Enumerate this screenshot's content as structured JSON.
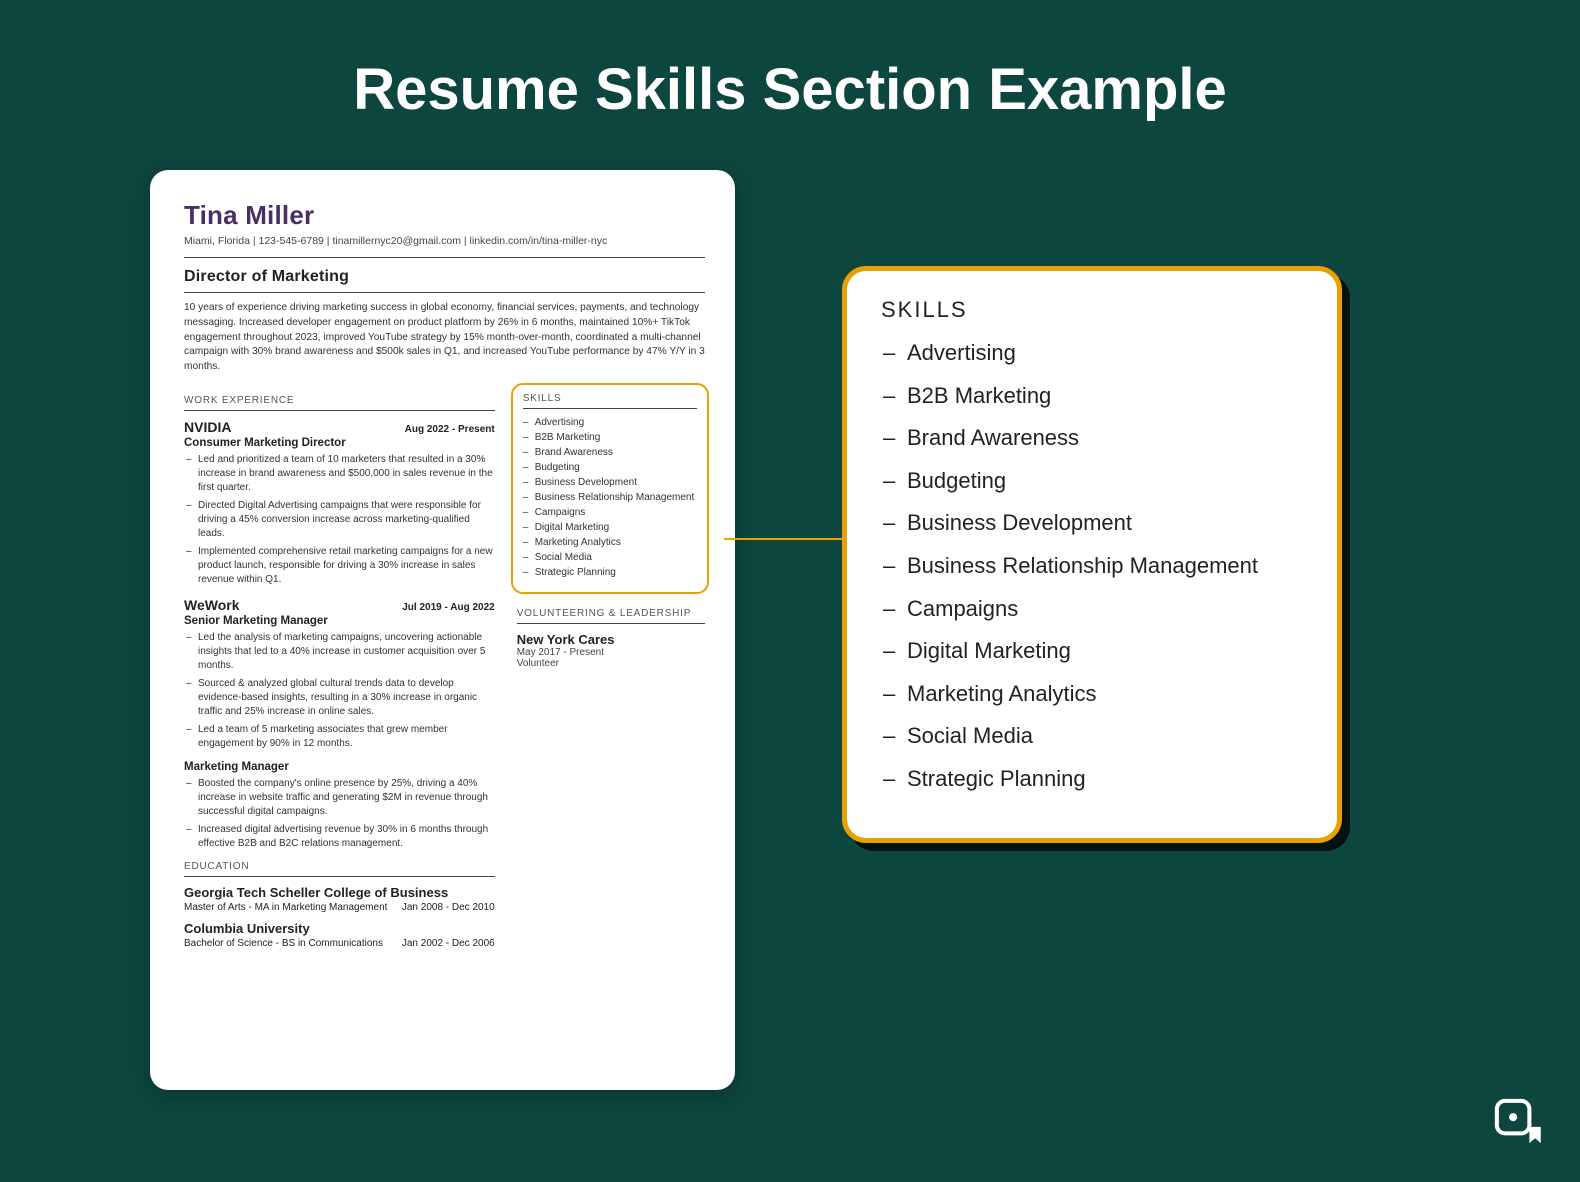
{
  "title": "Resume Skills Section Example",
  "resume": {
    "name": "Tina Miller",
    "contact": "Miami, Florida | 123-545-6789 | tinamillernyc20@gmail.com | linkedin.com/in/tina-miller-nyc",
    "role": "Director of Marketing",
    "summary": "10 years of experience driving marketing success in global economy, financial services, payments, and technology messaging. Increased developer engagement on product platform by 26% in 6 months, maintained 10%+ TikTok engagement throughout 2023, improved YouTube strategy by 15% month-over-month, coordinated a multi-channel campaign with 30% brand awareness and $500k sales in Q1, and increased YouTube performance by 47% Y/Y in 3 months.",
    "sections": {
      "work": "WORK EXPERIENCE",
      "skills": "SKILLS",
      "volunteering": "VOLUNTEERING & LEADERSHIP",
      "education": "EDUCATION"
    },
    "jobs": [
      {
        "company": "NVIDIA",
        "dates": "Aug 2022 - Present",
        "title": "Consumer Marketing Director",
        "bullets": [
          "Led and prioritized a team of 10 marketers that resulted in a 30% increase in brand awareness and $500,000 in sales revenue in the first quarter.",
          "Directed Digital Advertising campaigns that were responsible for driving a 45% conversion increase across marketing-qualified leads.",
          "Implemented comprehensive retail marketing campaigns for a new product launch, responsible for driving a 30% increase in sales revenue within Q1."
        ]
      },
      {
        "company": "WeWork",
        "dates": "Jul 2019 - Aug 2022",
        "title": "Senior Marketing Manager",
        "bullets": [
          "Led the analysis of marketing campaigns, uncovering actionable insights that led to a 40% increase in customer acquisition over 5 months.",
          "Sourced & analyzed global cultural trends data to develop evidence-based insights, resulting in a 30% increase in organic traffic and 25% increase in online sales.",
          "Led a team of 5 marketing associates that grew member engagement by 90% in 12 months."
        ]
      },
      {
        "company": "",
        "dates": "",
        "title": "Marketing Manager",
        "bullets": [
          "Boosted the company's online presence by 25%, driving a 40% increase in website traffic and generating $2M in revenue through successful digital campaigns.",
          "Increased digital advertising revenue by 30% in 6 months through effective B2B and B2C relations management."
        ]
      }
    ],
    "skills": [
      "Advertising",
      "B2B Marketing",
      "Brand Awareness",
      "Budgeting",
      "Business Development",
      "Business Relationship Management",
      "Campaigns",
      "Digital Marketing",
      "Marketing Analytics",
      "Social Media",
      "Strategic Planning"
    ],
    "volunteering": {
      "org": "New York Cares",
      "dates": "May 2017 - Present",
      "role": "Volunteer"
    },
    "education": [
      {
        "school": "Georgia Tech Scheller College of Business",
        "degree": "Master of Arts - MA in Marketing Management",
        "dates": "Jan 2008 - Dec 2010"
      },
      {
        "school": "Columbia University",
        "degree": "Bachelor of Science - BS in Communications",
        "dates": "Jan 2002 - Dec 2006"
      }
    ]
  },
  "zoom": {
    "heading": "SKILLS"
  }
}
